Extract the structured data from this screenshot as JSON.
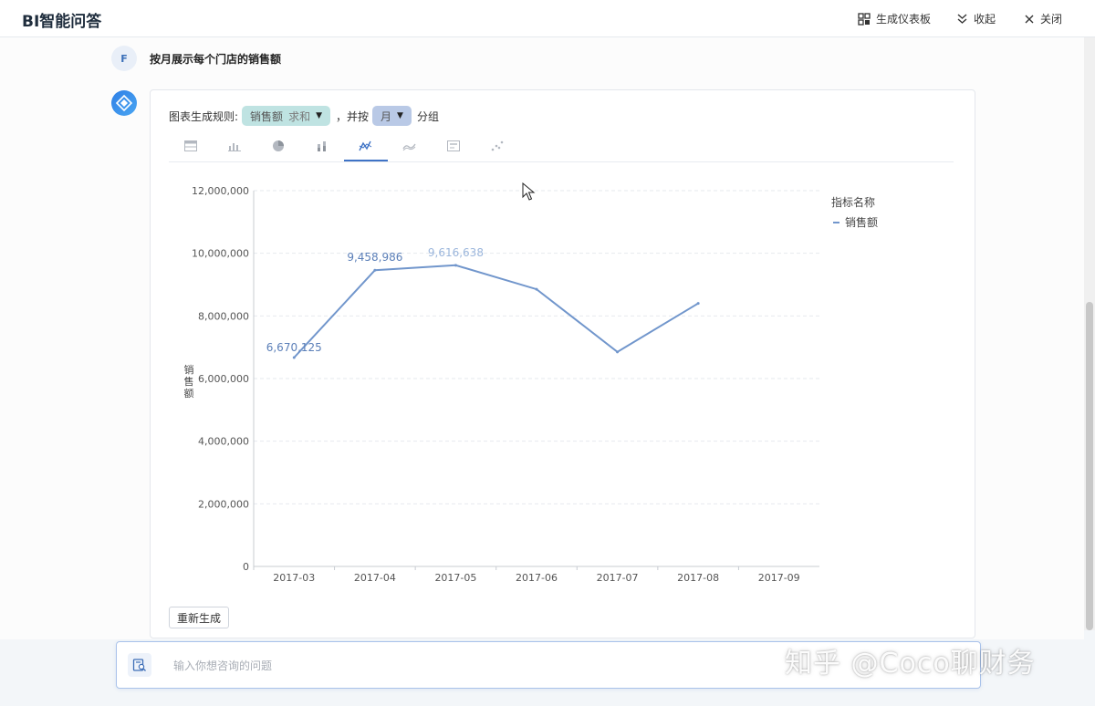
{
  "header": {
    "title": "BI智能问答",
    "actions": [
      {
        "label": "生成仪表板",
        "icon": "dashboard-icon"
      },
      {
        "label": "收起",
        "icon": "collapse-icon"
      },
      {
        "label": "关闭",
        "icon": "close-icon"
      }
    ]
  },
  "conversation": {
    "user_avatar": "F",
    "question": "按月展示每个门店的销售额"
  },
  "answer": {
    "rule_label": "图表生成规则:",
    "measure": {
      "name": "销售额",
      "agg": "求和"
    },
    "connector": "，并按",
    "dimension": "月",
    "group_suffix": "分组",
    "chart_tabs": [
      {
        "icon": "table-icon",
        "active": false
      },
      {
        "icon": "bar-chart-icon",
        "active": false
      },
      {
        "icon": "pie-chart-icon",
        "active": false
      },
      {
        "icon": "stacked-bar-icon",
        "active": false
      },
      {
        "icon": "line-chart-icon",
        "active": true
      },
      {
        "icon": "area-chart-icon",
        "active": false
      },
      {
        "icon": "kpi-card-icon",
        "active": false
      },
      {
        "icon": "scatter-icon",
        "active": false
      }
    ],
    "regenerate_label": "重新生成"
  },
  "chart_data": {
    "type": "line",
    "title": "",
    "xlabel": "",
    "ylabel": "销售额",
    "categories": [
      "2017-03",
      "2017-04",
      "2017-05",
      "2017-06",
      "2017-07",
      "2017-08",
      "2017-09"
    ],
    "series": [
      {
        "name": "销售额",
        "values": [
          6670125,
          9458986,
          9616638,
          8850000,
          6850000,
          8400000,
          null
        ]
      }
    ],
    "data_labels": [
      {
        "index": 0,
        "text": "6,670,125"
      },
      {
        "index": 1,
        "text": "9,458,986"
      },
      {
        "index": 2,
        "text": "9,616,638"
      }
    ],
    "ylim": [
      0,
      12000000
    ],
    "y_ticks": [
      0,
      2000000,
      4000000,
      6000000,
      8000000,
      10000000,
      12000000
    ],
    "y_tick_labels": [
      "0",
      "2,000,000",
      "4,000,000",
      "6,000,000",
      "8,000,000",
      "10,000,000",
      "12,000,000"
    ],
    "grid": true,
    "legend": {
      "title": "指标名称",
      "position": "top-right"
    },
    "colors": {
      "line": "#7196cc",
      "label": "#5b7fb8",
      "faded_label": "#9bb6dc"
    }
  },
  "input": {
    "placeholder": "输入你想咨询的问题"
  },
  "watermark": "知乎 @Coco聊财务"
}
